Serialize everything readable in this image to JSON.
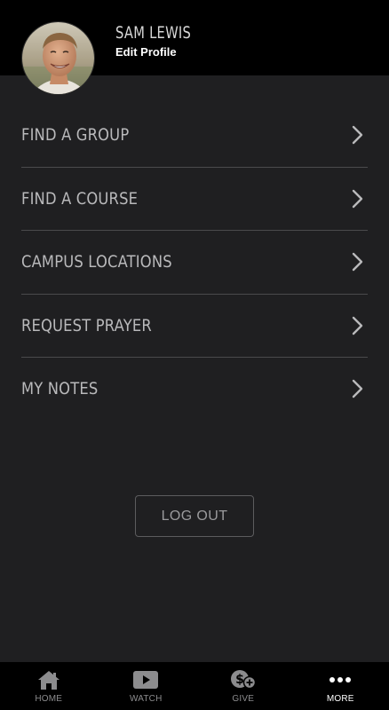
{
  "profile": {
    "name": "SAM LEWIS",
    "edit_label": "Edit Profile"
  },
  "menu": {
    "items": [
      {
        "label": "FIND A GROUP",
        "icon": "chevron-right-icon"
      },
      {
        "label": "FIND A COURSE",
        "icon": "chevron-right-icon"
      },
      {
        "label": "CAMPUS LOCATIONS",
        "icon": "chevron-right-icon"
      },
      {
        "label": "REQUEST PRAYER",
        "icon": "chevron-right-icon"
      },
      {
        "label": "MY NOTES",
        "icon": "chevron-right-icon"
      }
    ]
  },
  "logout": {
    "label": "LOG OUT"
  },
  "tabbar": {
    "tabs": [
      {
        "label": "HOME",
        "icon": "home-icon",
        "active": false
      },
      {
        "label": "WATCH",
        "icon": "play-video-icon",
        "active": false
      },
      {
        "label": "GIVE",
        "icon": "give-money-icon",
        "active": false
      },
      {
        "label": "MORE",
        "icon": "more-dots-icon",
        "active": true
      }
    ]
  },
  "colors": {
    "background": "#1f1f21",
    "header": "#000000",
    "menu_text": "#b9b9bb",
    "divider": "#4a4a4c",
    "tab_inactive": "#8c8c8e",
    "tab_active": "#ffffff"
  }
}
